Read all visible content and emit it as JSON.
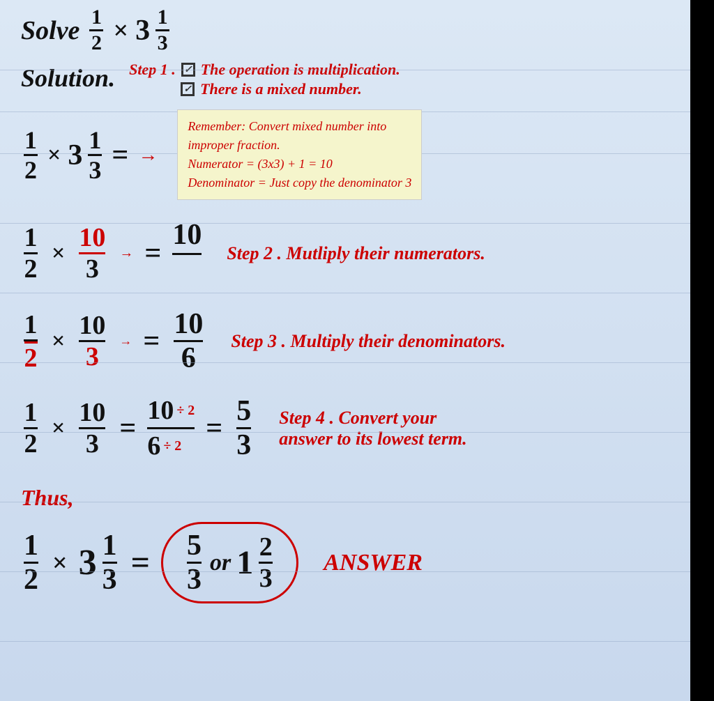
{
  "title": {
    "solve_label": "Solve",
    "frac1": {
      "num": "1",
      "den": "2"
    },
    "op": "×",
    "whole": "3",
    "frac2": {
      "num": "1",
      "den": "3"
    }
  },
  "solution": {
    "label": "Solution.",
    "step1": {
      "line1": "Step 1 .",
      "check1": "✓",
      "text1": "The operation is multiplication.",
      "check2": "✓",
      "text2": "There is a mixed number."
    },
    "note": {
      "line1": "Remember: Convert mixed number into",
      "line2": "improper fraction.",
      "line3": "Numerator = (3x3) + 1 = 10",
      "line4": "Denominator = Just copy the denominator 3"
    }
  },
  "step2": {
    "desc": "Step 2 . Mutliply their numerators.",
    "frac1": {
      "num": "1",
      "den": "2"
    },
    "op": "×",
    "frac2_num": "10",
    "frac2_den": "3",
    "equals": "=",
    "result_num": "10"
  },
  "step3": {
    "desc": "Step 3 . Multiply their denominators.",
    "frac1": {
      "num": "1",
      "den": "2"
    },
    "op": "×",
    "frac2": {
      "num": "10",
      "den": "3"
    },
    "equals": "=",
    "result": {
      "num": "10",
      "den": "6"
    }
  },
  "step4": {
    "desc": "Step 4 . Convert your\nanswer to its lowest term.",
    "frac1": {
      "num": "1",
      "den": "2"
    },
    "op": "×",
    "frac2": {
      "num": "10",
      "den": "3"
    },
    "eq1": "=",
    "mid_num": "10",
    "mid_div_num": "÷ 2",
    "mid_den": "6",
    "mid_div_den": "÷ 2",
    "eq2": "=",
    "result": {
      "num": "5",
      "den": "3"
    }
  },
  "thus": {
    "label": "Thus,",
    "frac1": {
      "num": "1",
      "den": "2"
    },
    "op": "×",
    "whole": "3",
    "frac2": {
      "num": "1",
      "den": "3"
    },
    "equals": "=",
    "ans1": {
      "num": "5",
      "den": "3"
    },
    "or": "or",
    "whole2": "1",
    "ans2": {
      "num": "2",
      "den": "3"
    },
    "answer_label": "ANSWER"
  },
  "lines_count": 18
}
